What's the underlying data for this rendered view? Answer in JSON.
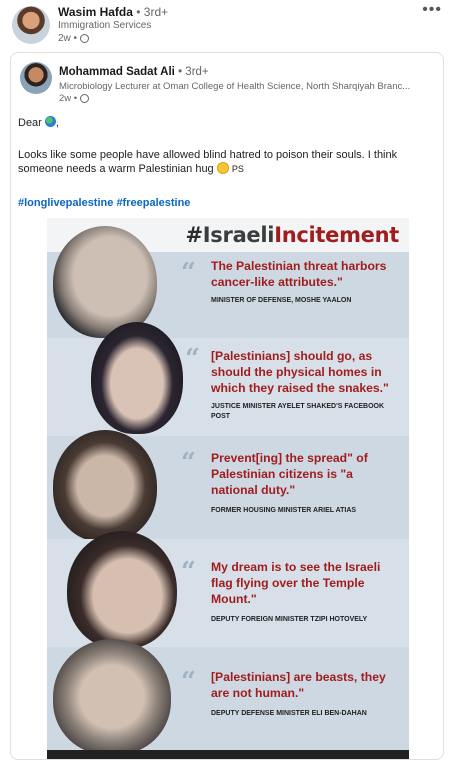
{
  "post": {
    "author": {
      "name": "Wasim Hafda",
      "degree": "• 3rd+",
      "headline": "Immigration Services",
      "time": "2w •"
    },
    "more_icon": "more-horizontal-icon"
  },
  "reshare": {
    "author": {
      "name": "Mohammad Sadat Ali",
      "degree": "• 3rd+",
      "headline": "Microbiology Lecturer at Oman College of Health Science, North Sharqiyah Branc...",
      "time": "2w •"
    },
    "text": {
      "greeting": "Dear",
      "greeting_end": ",",
      "body": "Looks like some people have allowed blind hatred to poison their souls. I think someone needs a warm Palestinian hug",
      "body_end": "PS",
      "hashtag1": "#longlivepalestine",
      "hashtag2": "#freepalestine"
    },
    "graphic": {
      "title_hash": "#",
      "title_israeli": "Israeli",
      "title_incitement": "Incitement",
      "quotes": [
        {
          "text": "The Palestinian threat harbors cancer-like attributes.\"",
          "attribution": "Minister of Defense, Moshe Yaalon"
        },
        {
          "text": "[Palestinians] should go, as should the physical homes in which they raised the snakes.\"",
          "attribution": "Justice Minister Ayelet Shaked's Facebook Post"
        },
        {
          "text": "Prevent[ing] the spread\" of Palestinian citizens is \"a national duty.\"",
          "attribution": "Former Housing Minister Ariel Atias"
        },
        {
          "text": "My dream is to see the Israeli flag flying over the Temple Mount.\"",
          "attribution": "Deputy Foreign Minister Tzipi Hotovely"
        },
        {
          "text": "[Palestinians] are beasts, they are not human.\"",
          "attribution": "Deputy Defense Minister Eli Ben-Dahan"
        }
      ],
      "quote_mark": "“"
    }
  },
  "colors": {
    "accent_red": "#a11d1d",
    "link_blue": "#0a66c2",
    "panel": "#cdd8e2"
  }
}
